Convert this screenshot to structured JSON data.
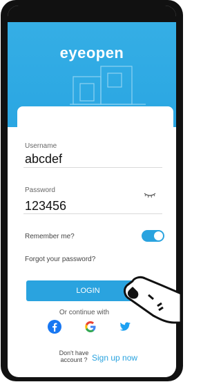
{
  "brand": {
    "logo_text": "eyeopen"
  },
  "form": {
    "username_label": "Username",
    "username_value": "abcdef",
    "password_label": "Password",
    "password_value": "123456",
    "remember_label": "Remember me?",
    "remember_on": true,
    "forgot_label": "Forgot your password?"
  },
  "actions": {
    "login_label": "LOGIN",
    "continue_label": "Or continue with",
    "no_account_label": "Don't have account ?",
    "signup_label": "Sign up now"
  },
  "social": [
    {
      "name": "facebook-icon"
    },
    {
      "name": "google-icon"
    },
    {
      "name": "twitter-icon"
    }
  ],
  "colors": {
    "accent": "#2aa3df",
    "header": "#35aee5",
    "frame": "#111111"
  }
}
